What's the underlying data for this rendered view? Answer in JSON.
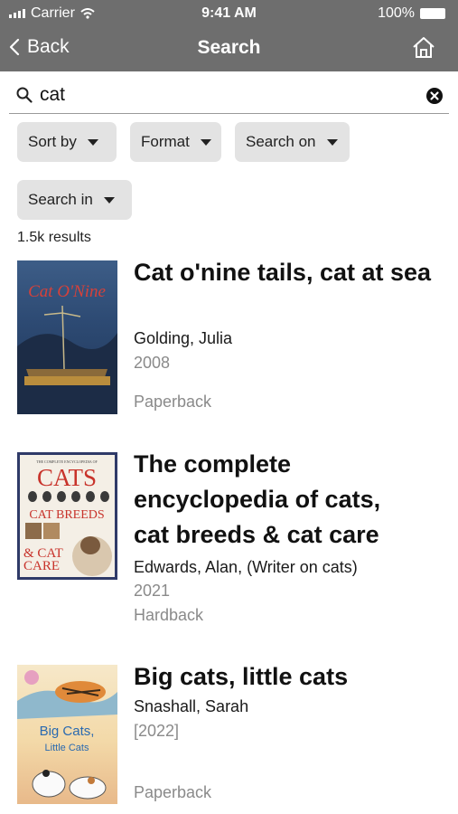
{
  "status_bar": {
    "carrier": "Carrier",
    "time": "9:41 AM",
    "battery": "100%",
    "signal_icon": "signal-icon",
    "wifi_icon": "wifi-icon",
    "battery_icon": "battery-icon"
  },
  "nav": {
    "back_label": "Back",
    "title": "Search",
    "home_icon": "home-icon"
  },
  "search": {
    "value": "cat",
    "icon": "search-icon",
    "clear_icon": "clear-icon"
  },
  "filters": [
    {
      "label": "Sort by"
    },
    {
      "label": "Format"
    },
    {
      "label": "Search on"
    },
    {
      "label": "Search in"
    }
  ],
  "results_count": "1.5k results",
  "results": [
    {
      "title": "Cat o'nine tails, cat at sea",
      "author": "Golding, Julia",
      "year": "2008",
      "format": "Paperback",
      "cover_text": "Cat O'Nine"
    },
    {
      "title": "The complete encyclopedia of cats, cat breeds & cat care",
      "author": "Edwards, Alan, (Writer on cats)",
      "year": "2021",
      "format": "Hardback",
      "cover_text_top": "THE COMPLETE ENCYCLOPEDIA OF",
      "cover_text_1": "CATS",
      "cover_text_2": "CAT BREEDS",
      "cover_text_3": "& CAT",
      "cover_text_4": "CARE"
    },
    {
      "title": "Big cats, little cats",
      "author": "Snashall, Sarah",
      "year": "[2022]",
      "format": "Paperback",
      "cover_text_1": "Big Cats,",
      "cover_text_2": "Little Cats"
    }
  ],
  "colors": {
    "header_bg": "#6e6e6e",
    "chip_bg": "#e3e3e3",
    "muted_text": "#8a8a8a"
  }
}
